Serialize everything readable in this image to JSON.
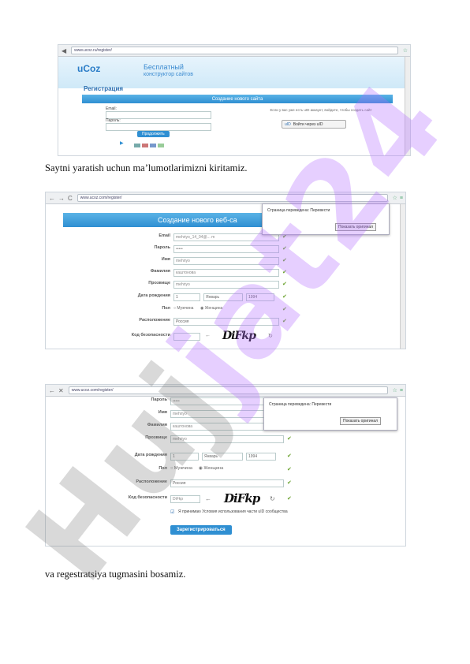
{
  "captions": {
    "first": "Saytni yaratish uchun ma’lumotlarimizni kiritamiz.",
    "second": "va regestratsiya tugmasini bosamiz."
  },
  "watermark": {
    "part1": "Huj",
    "part2": "jat24"
  },
  "shot1": {
    "url": "www.ucoz.ru/register/",
    "logo": "uCoz",
    "banner_title": "Бесплатный",
    "banner_sub": "конструктор сайтов",
    "heading": "Регистрация",
    "section": "Создание нового сайта",
    "label_email": "Email:",
    "label_password": "Пароль:",
    "submit": "Продолжить",
    "info": "Если у вас уже есть uID аккаунт, войдите, чтобы создать сайт",
    "uid_button": "Войти через uID"
  },
  "shot2": {
    "url": "www.ucoz.com/register/",
    "section": "Создание нового веб-са",
    "popup_text": "Страница переведена: Перевести",
    "popup_btn": "Показать оригинал",
    "fields": [
      {
        "label": "Email",
        "value": "mehriyo_14_04@... m"
      },
      {
        "label": "Пароль",
        "value": "•••••"
      },
      {
        "label": "Имя",
        "value": "mehriyo"
      },
      {
        "label": "Фамилия",
        "value": "каштонова"
      },
      {
        "label": "Прозвище",
        "value": "mehriyo"
      }
    ],
    "dob_label": "Дата рождения",
    "dob": [
      "1",
      "Январь",
      "1994"
    ],
    "sex_label": "Пол",
    "sex_options": [
      "Мужчина",
      "Женщина"
    ],
    "loc_label": "Расположение",
    "loc_value": "Россия",
    "code_label": "Код безопасности",
    "captcha": "DiFkp"
  },
  "shot3": {
    "url": "www.ucoz.com/register/",
    "popup_text": "Страница переведена: Перевести",
    "popup_btn": "Показать оригинал",
    "fields": [
      {
        "label": "Пароль",
        "value": "•••••"
      },
      {
        "label": "Имя",
        "value": "mehriyo"
      },
      {
        "label": "Фамилия",
        "value": "каштонова"
      },
      {
        "label": "Прозвище",
        "value": "mehriyo"
      }
    ],
    "dob_label": "Дата рождения",
    "dob": [
      "1",
      "Январь",
      "1994"
    ],
    "sex_label": "Пол",
    "sex_options": [
      "Мужчина",
      "Женщина"
    ],
    "loc_label": "Расположение",
    "loc_value": "Россия",
    "code_label": "Код безопасности",
    "code_value": "DiFkp",
    "captcha": "DiFkp",
    "terms": "Я принимаю Условия использования части uID сообщества",
    "register_btn": "Зарегистрироваться"
  }
}
